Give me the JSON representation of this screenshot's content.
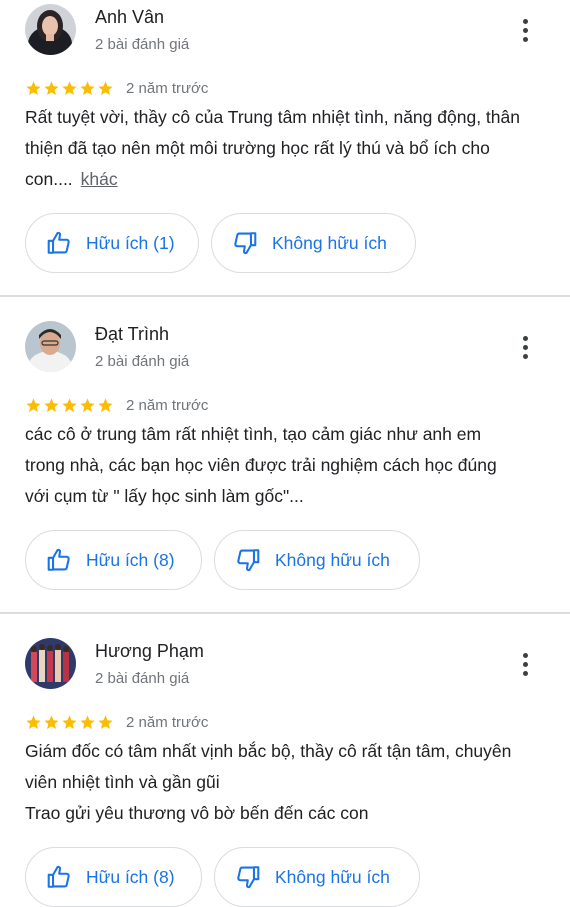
{
  "reviews": [
    {
      "name": "Anh Vân",
      "count": "2 bài đánh giá",
      "time": "2 năm trước",
      "lines": [
        "Rất tuyệt vời, thầy cô của Trung tâm nhiệt tình, năng động, thân",
        "thiện đã tạo nên một môi trường học rất lý thú và bổ ích cho",
        "con...."
      ],
      "more": "khác",
      "helpful": "Hữu ích (1)",
      "not_helpful": "Không hữu ích",
      "rating": 5
    },
    {
      "name": "Đạt Trình",
      "count": "2 bài đánh giá",
      "time": "2 năm trước",
      "lines": [
        "các cô ở trung tâm rất nhiệt tình, tạo cảm giác như anh em",
        "trong nhà, các bạn học viên được trải nghiệm cách học đúng",
        "với cụm từ \" lấy học sinh làm gốc\"..."
      ],
      "helpful": "Hữu ích (8)",
      "not_helpful": "Không hữu ích",
      "rating": 5
    },
    {
      "name": "Hương Phạm",
      "count": "2 bài đánh giá",
      "time": "2 năm trước",
      "lines": [
        "Giám đốc có tâm nhất vịnh bắc bộ, thầy cô rất tận tâm, chuyên",
        "viên nhiệt tình và gần gũi",
        "Trao gửi yêu thương vô bờ bến đến các con"
      ],
      "helpful": "Hữu ích (8)",
      "not_helpful": "Không hữu ích",
      "rating": 5
    }
  ],
  "colors": {
    "star": "#fbbc04",
    "link": "#1a73e8",
    "divider": "#dadce0"
  }
}
